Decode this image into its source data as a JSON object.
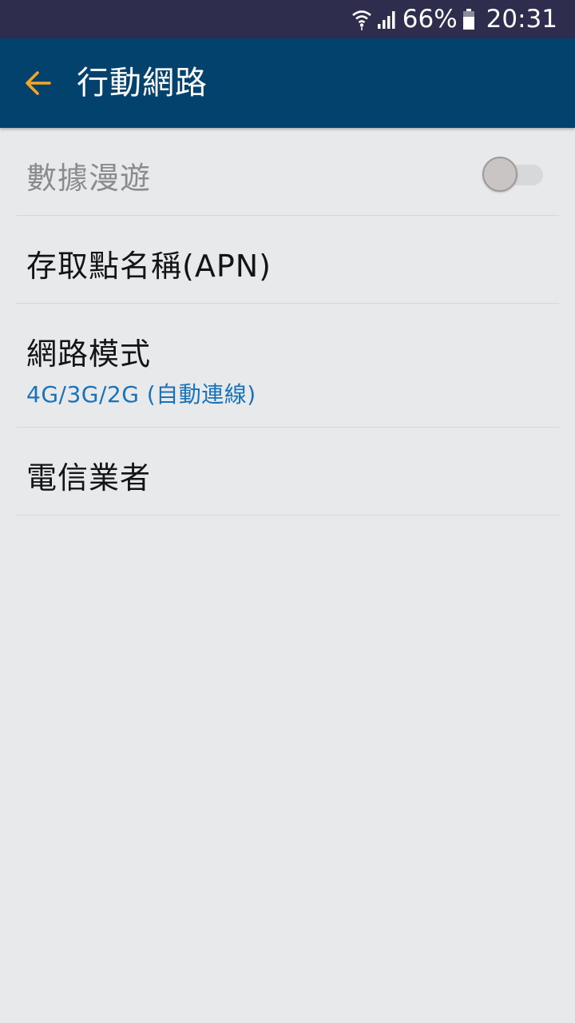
{
  "status_bar": {
    "battery_percent": "66%",
    "time": "20:31",
    "icons": [
      "wifi-icon",
      "signal-icon",
      "battery-icon"
    ]
  },
  "app_bar": {
    "title": "行動網路",
    "back_icon": "arrow-left-icon",
    "accent_color": "#f5a623",
    "background_color": "#04426e"
  },
  "settings": {
    "data_roaming": {
      "label": "數據漫遊",
      "enabled": false,
      "toggle_on": false
    },
    "apn": {
      "label": "存取點名稱(APN)"
    },
    "network_mode": {
      "label": "網路模式",
      "value": "4G/3G/2G (自動連線)",
      "value_color": "#1a73b8"
    },
    "carrier": {
      "label": "電信業者"
    }
  }
}
